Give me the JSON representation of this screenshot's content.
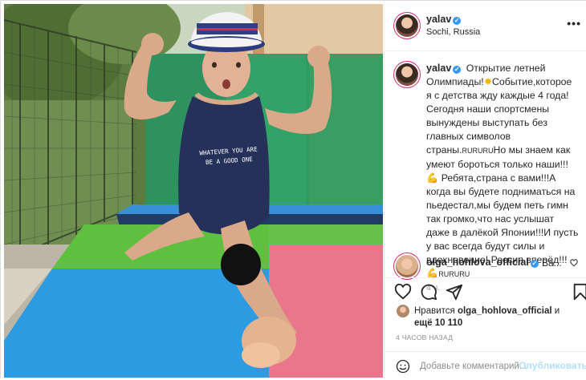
{
  "post": {
    "username": "yalav",
    "location": "Sochi, Russia",
    "shirt_text_line1": "WHATEVER YOU ARE",
    "shirt_text_line2": "BE A GOOD ONE",
    "caption_part1": "Открытие летней Олимпиады!",
    "caption_part2": "Событие,которое я с детства жду каждые 4 года!Сегодня наши спортсмены вынуждены выступать без главных символов страны.",
    "caption_ru1": "RURURU",
    "caption_part3": "Но мы знаем как умеют бороться только наши!!!",
    "caption_part4": "Ребята,страна с вами!!!А когда вы будете подниматься на пьедестал,мы будем петь гимн так громко,что нас услышат даже в далёкой Японии!!!И пусть у вас всегда будут силы и вдохновение! Россия вперёд!!!",
    "caption_ru2": "RURURU",
    "time": "4 ч.",
    "verified_mark": "✓",
    "menu_dots": "•••"
  },
  "comment": {
    "username": "olga_hohlova_official",
    "text": "Ва..."
  },
  "likes": {
    "prefix": "Нравится",
    "username": "olga_hohlova_official",
    "and": "и",
    "suffix": "ещё 10 110"
  },
  "ago": "4 ЧАСОВ НАЗАД",
  "comment_box": {
    "placeholder": "Добавьте комментарий...",
    "publish": "Опубликовать"
  },
  "icons": [
    "heart-icon",
    "comment-icon",
    "share-icon",
    "bookmark-icon",
    "smile-icon",
    "more-icon"
  ],
  "colors": {
    "accent": "#3897f0",
    "publish_disabled": "#b2dffc",
    "ring": "#d62976"
  }
}
